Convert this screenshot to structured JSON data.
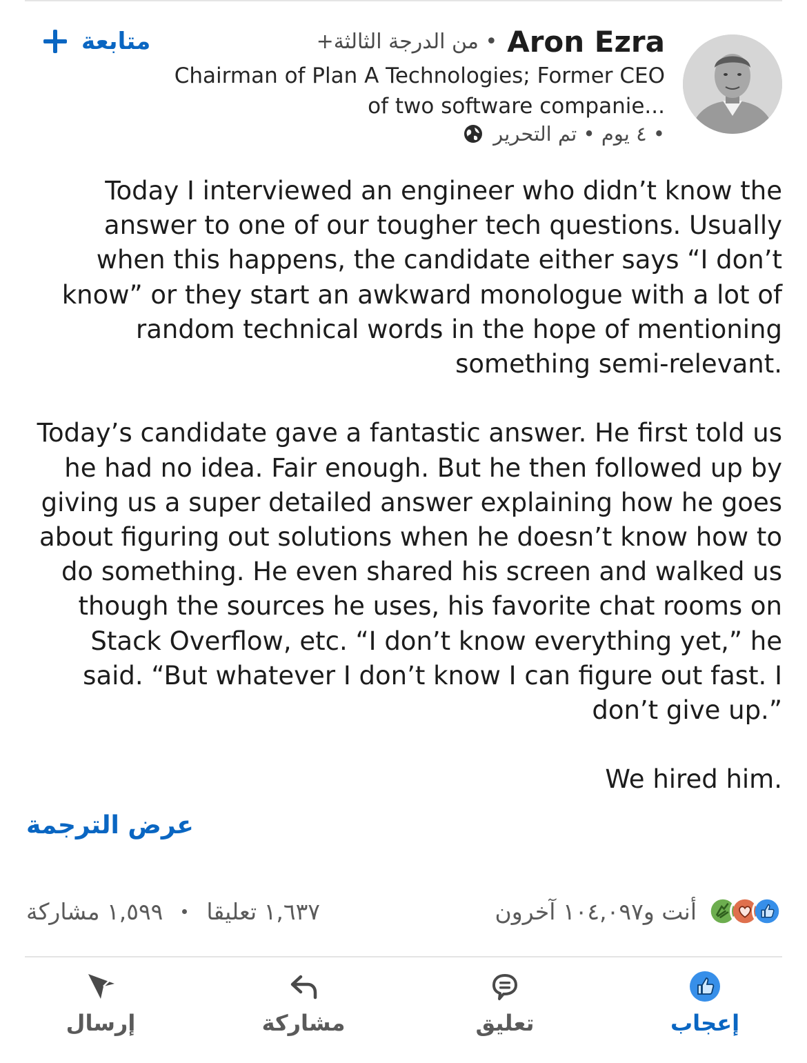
{
  "post": {
    "author": {
      "name": "Aron Ezra",
      "degree": "• من الدرجة الثالثة+",
      "headline": "Chairman of Plan A Technologies; Former CEO of two software companie...",
      "meta": "٤ يوم • تم التحرير •",
      "visibility_icon": "globe-icon"
    },
    "follow_label": "متابعة",
    "paragraphs": [
      "Today I interviewed an engineer who didn’t know the answer to one of our tougher tech questions.  Usually when this happens, the candidate either says “I don’t know” or they start an awkward monologue with a lot of random technical words in the hope of mentioning something semi-relevant.",
      "Today’s candidate gave a fantastic answer. He first told us he had no idea. Fair enough.  But he then followed up by giving us a super detailed answer explaining how he goes about figuring out solutions when he doesn’t know how to do something. He even shared his screen and walked us though the sources he uses, his favorite chat rooms on Stack Overflow, etc.  “I don’t know everything yet,” he said. “But whatever I don’t know I can figure out fast. I don’t give up.”",
      "We hired him."
    ],
    "translate_label": "عرض الترجمة"
  },
  "stats": {
    "reactions_text": "أنت و١٠٤,٠٩٧ آخرون",
    "reaction_icons": [
      "like-icon",
      "love-icon",
      "celebrate-icon"
    ],
    "comments": "١,٦٣٧ تعليقا",
    "shares": "١,٥٩٩ مشاركة"
  },
  "actions": {
    "like": "إعجاب",
    "comment": "تعليق",
    "share": "مشاركة",
    "send": "إرسال"
  },
  "colors": {
    "accent": "#0a66c2",
    "text": "#1c1c1c",
    "muted": "#5a5a5a",
    "love": "#df704d",
    "celebrate": "#6dae4f"
  }
}
